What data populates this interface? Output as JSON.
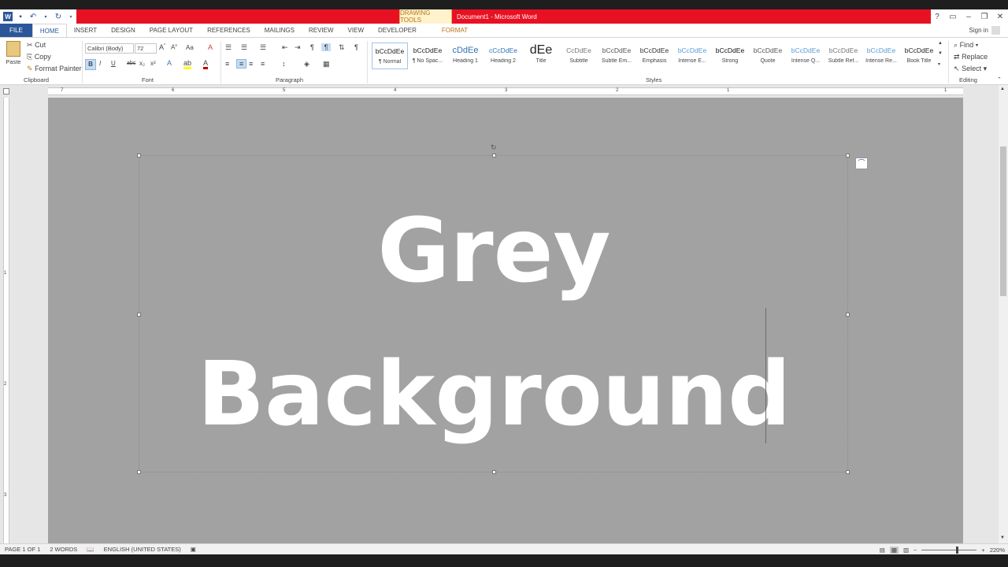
{
  "window": {
    "title": "Document1 - Microsoft Word",
    "contextual_tab_group": "DRAWING TOOLS",
    "help": "?",
    "controls": [
      "ribbon-options",
      "minimize",
      "restore",
      "close"
    ]
  },
  "tabs": [
    "FILE",
    "HOME",
    "INSERT",
    "DESIGN",
    "PAGE LAYOUT",
    "REFERENCES",
    "MAILINGS",
    "REVIEW",
    "VIEW",
    "DEVELOPER",
    "FORMAT"
  ],
  "active_tab": "HOME",
  "sign_in": "Sign in",
  "clipboard": {
    "paste": "Paste",
    "cut": "Cut",
    "copy": "Copy",
    "format_painter": "Format Painter",
    "label": "Clipboard"
  },
  "font": {
    "family": "Calibri (Body)",
    "size": "72",
    "label": "Font",
    "change_case": "Aa",
    "bold": "B",
    "italic": "I",
    "underline": "U",
    "strike": "abc",
    "subscript": "x₂",
    "superscript": "x²"
  },
  "paragraph": {
    "label": "Paragraph"
  },
  "styles": {
    "label": "Styles",
    "items": [
      {
        "sample": "bCcDdEe",
        "name": "¶ Normal",
        "color": "#222222"
      },
      {
        "sample": "bCcDdEe",
        "name": "¶ No Spac...",
        "color": "#222222"
      },
      {
        "sample": "cDdEe",
        "name": "Heading 1",
        "color": "#2e74b5"
      },
      {
        "sample": "cCcDdEe",
        "name": "Heading 2",
        "color": "#2e74b5"
      },
      {
        "sample": "dEe",
        "name": "Title",
        "color": "#222222"
      },
      {
        "sample": "CcDdEe",
        "name": "Subtitle",
        "color": "#777777"
      },
      {
        "sample": "bCcDdEe",
        "name": "Subtle Em...",
        "color": "#555555"
      },
      {
        "sample": "bCcDdEe",
        "name": "Emphasis",
        "color": "#333333"
      },
      {
        "sample": "bCcDdEe",
        "name": "Intense E...",
        "color": "#5b9bd5"
      },
      {
        "sample": "bCcDdEe",
        "name": "Strong",
        "color": "#111111"
      },
      {
        "sample": "bCcDdEe",
        "name": "Quote",
        "color": "#555555"
      },
      {
        "sample": "bCcDdEe",
        "name": "Intense Q...",
        "color": "#5b9bd5"
      },
      {
        "sample": "bCcDdEe",
        "name": "Subtle Ref...",
        "color": "#777777"
      },
      {
        "sample": "bCcDdEe",
        "name": "Intense Re...",
        "color": "#5b9bd5"
      },
      {
        "sample": "bCcDdEe",
        "name": "Book Title",
        "color": "#222222"
      }
    ]
  },
  "editing": {
    "label": "Editing",
    "find": "Find",
    "replace": "Replace",
    "select": "Select"
  },
  "ruler": {
    "numbers": [
      "7",
      "6",
      "5",
      "4",
      "3",
      "2",
      "1",
      "1"
    ]
  },
  "vruler": {
    "numbers": [
      "1",
      "2",
      "3"
    ]
  },
  "document": {
    "line1": "Grey",
    "line2": "Background"
  },
  "status": {
    "page": "PAGE 1 OF 1",
    "words": "2 WORDS",
    "language": "ENGLISH (UNITED STATES)",
    "zoom": "220%",
    "zoom_minus": "−",
    "zoom_plus": "+"
  },
  "colors": {
    "title_bar": "#e81123",
    "file_tab": "#2b579a",
    "page_bg": "#a2a2a2",
    "text": "#ffffff"
  }
}
